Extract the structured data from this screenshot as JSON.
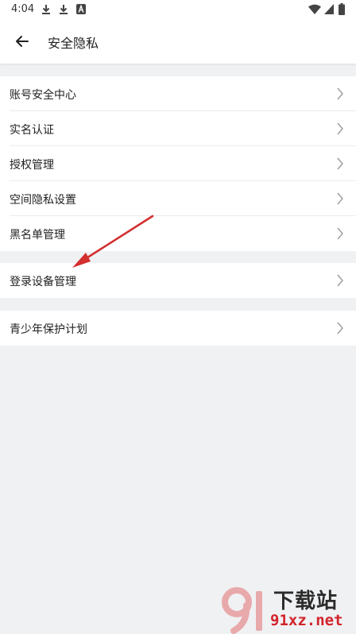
{
  "status_bar": {
    "time": "4:04",
    "left_icons": [
      "download-icon",
      "download-icon",
      "text-a-icon"
    ],
    "right_icons": [
      "wifi-icon",
      "signal-icon",
      "battery-icon"
    ]
  },
  "header": {
    "title": "安全隐私",
    "back_icon": "arrow-left-icon"
  },
  "groups": [
    {
      "items": [
        {
          "label": "账号安全中心"
        },
        {
          "label": "实名认证"
        },
        {
          "label": "授权管理"
        },
        {
          "label": "空间隐私设置"
        },
        {
          "label": "黑名单管理"
        }
      ]
    },
    {
      "items": [
        {
          "label": "登录设备管理"
        }
      ]
    },
    {
      "items": [
        {
          "label": "青少年保护计划"
        }
      ]
    }
  ],
  "annotation": {
    "color": "#d32f2f",
    "icon": "red-arrow-annotation"
  },
  "watermark": {
    "title": "下载站",
    "url": "91xz.net",
    "accent": "#d2232a"
  }
}
